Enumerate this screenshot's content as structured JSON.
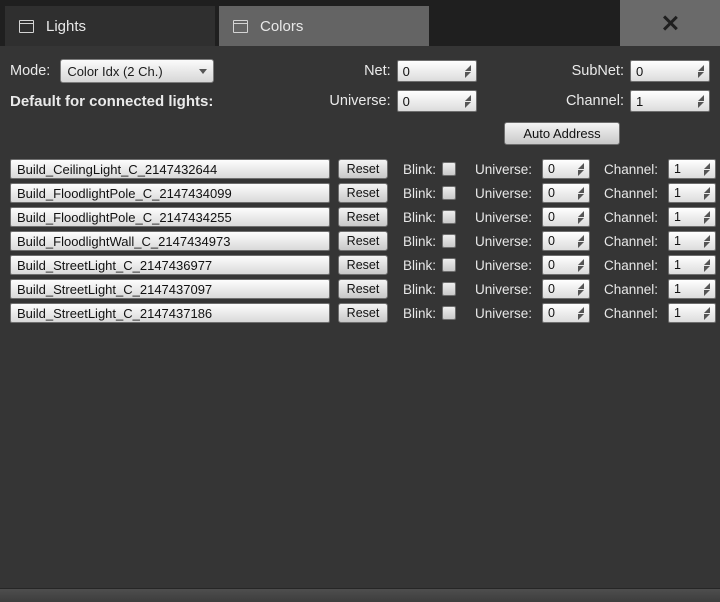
{
  "tabs": [
    {
      "label": "Lights",
      "active": false
    },
    {
      "label": "Colors",
      "active": true
    }
  ],
  "defaults": {
    "mode_label": "Mode:",
    "mode_value": "Color Idx (2 Ch.)",
    "connected_label": "Default for connected lights:",
    "net_label": "Net:",
    "net_value": "0",
    "subnet_label": "SubNet:",
    "subnet_value": "0",
    "universe_label": "Universe:",
    "universe_value": "0",
    "channel_label": "Channel:",
    "channel_value": "1",
    "auto_address_label": "Auto Address"
  },
  "row_labels": {
    "reset": "Reset",
    "blink": "Blink:",
    "universe": "Universe:",
    "channel": "Channel:"
  },
  "lights": [
    {
      "name": "Build_CeilingLight_C_2147432644",
      "blink": false,
      "universe": "0",
      "channel": "1"
    },
    {
      "name": "Build_FloodlightPole_C_2147434099",
      "blink": false,
      "universe": "0",
      "channel": "1"
    },
    {
      "name": "Build_FloodlightPole_C_2147434255",
      "blink": false,
      "universe": "0",
      "channel": "1"
    },
    {
      "name": "Build_FloodlightWall_C_2147434973",
      "blink": false,
      "universe": "0",
      "channel": "1"
    },
    {
      "name": "Build_StreetLight_C_2147436977",
      "blink": false,
      "universe": "0",
      "channel": "1"
    },
    {
      "name": "Build_StreetLight_C_2147437097",
      "blink": false,
      "universe": "0",
      "channel": "1"
    },
    {
      "name": "Build_StreetLight_C_2147437186",
      "blink": false,
      "universe": "0",
      "channel": "1"
    }
  ]
}
